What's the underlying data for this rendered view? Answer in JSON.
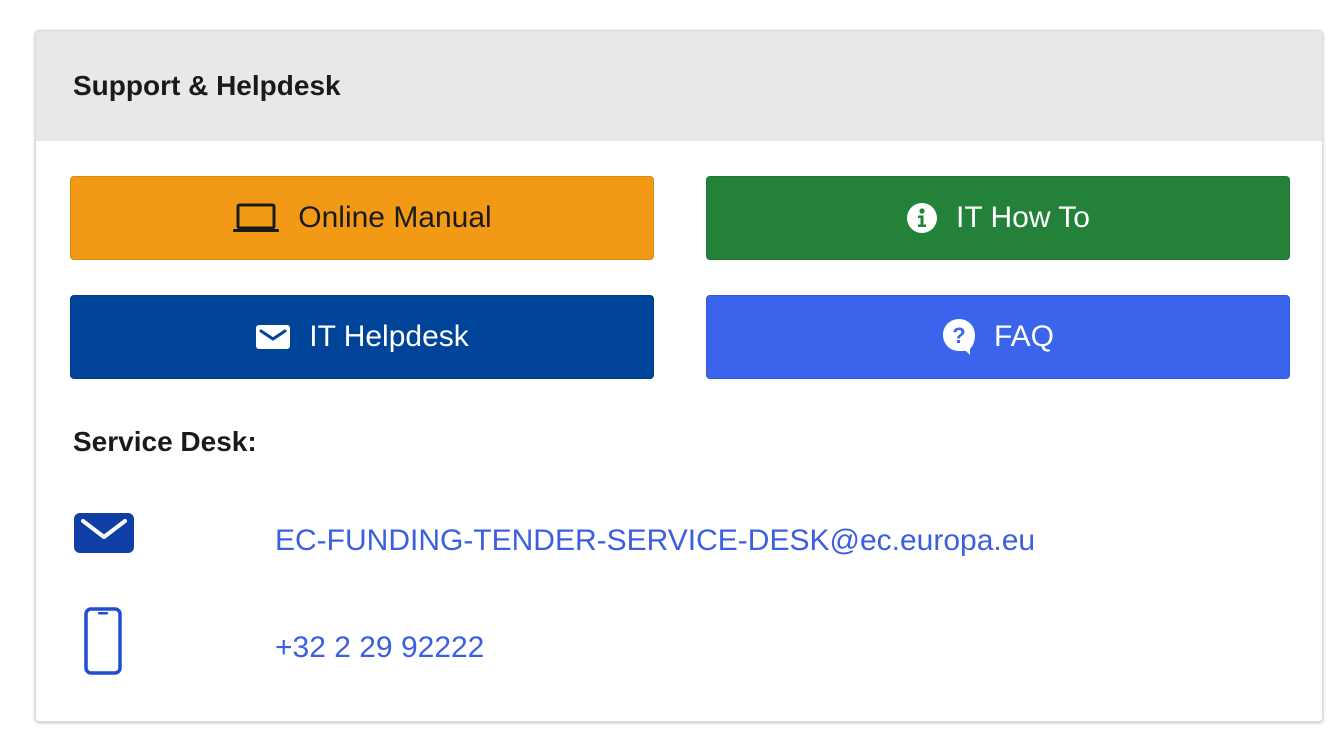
{
  "panel": {
    "title": "Support & Helpdesk"
  },
  "buttons": {
    "online_manual": {
      "label": "Online Manual",
      "icon": "laptop-icon",
      "color": "#f29a16"
    },
    "it_how_to": {
      "label": "IT How To",
      "icon": "info-circle-icon",
      "color": "#23813a"
    },
    "it_helpdesk": {
      "label": "IT Helpdesk",
      "icon": "envelope-icon",
      "color": "#00449a"
    },
    "faq": {
      "label": "FAQ",
      "icon": "question-bubble-icon",
      "color": "#3b64ec"
    }
  },
  "service_desk": {
    "heading": "Service Desk:",
    "email": {
      "value": "EC-FUNDING-TENDER-SERVICE-DESK@ec.europa.eu",
      "icon": "envelope-icon"
    },
    "phone": {
      "value": "+32 2 29 92222",
      "icon": "mobile-phone-icon"
    },
    "link_color": "#3b5fe0"
  }
}
